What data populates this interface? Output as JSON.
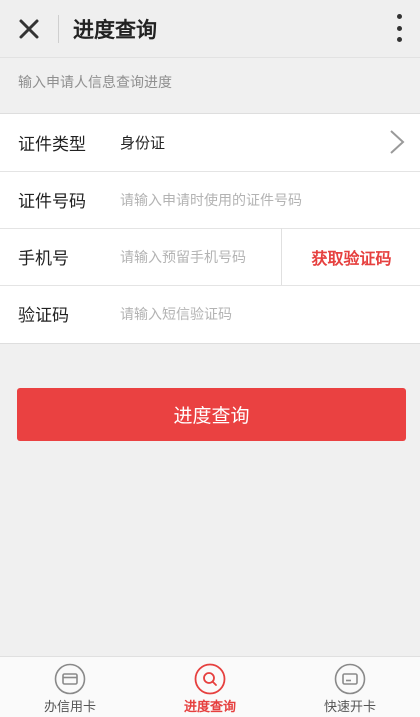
{
  "header": {
    "title": "进度查询"
  },
  "hint": "输入申请人信息查询进度",
  "form": {
    "id_type": {
      "label": "证件类型",
      "value": "身份证"
    },
    "id_number": {
      "label": "证件号码",
      "placeholder": "请输入申请时使用的证件号码"
    },
    "phone": {
      "label": "手机号",
      "placeholder": "请输入预留手机号码",
      "button": "获取验证码"
    },
    "code": {
      "label": "验证码",
      "placeholder": "请输入短信验证码"
    }
  },
  "submit_label": "进度查询",
  "tabbar": {
    "items": [
      {
        "label": "办信用卡",
        "icon": "card-icon",
        "active": false
      },
      {
        "label": "进度查询",
        "icon": "search-icon",
        "active": true
      },
      {
        "label": "快速开卡",
        "icon": "card-activate-icon",
        "active": false
      }
    ]
  },
  "colors": {
    "accent": "#ea4141",
    "background": "#f0f0f0"
  }
}
